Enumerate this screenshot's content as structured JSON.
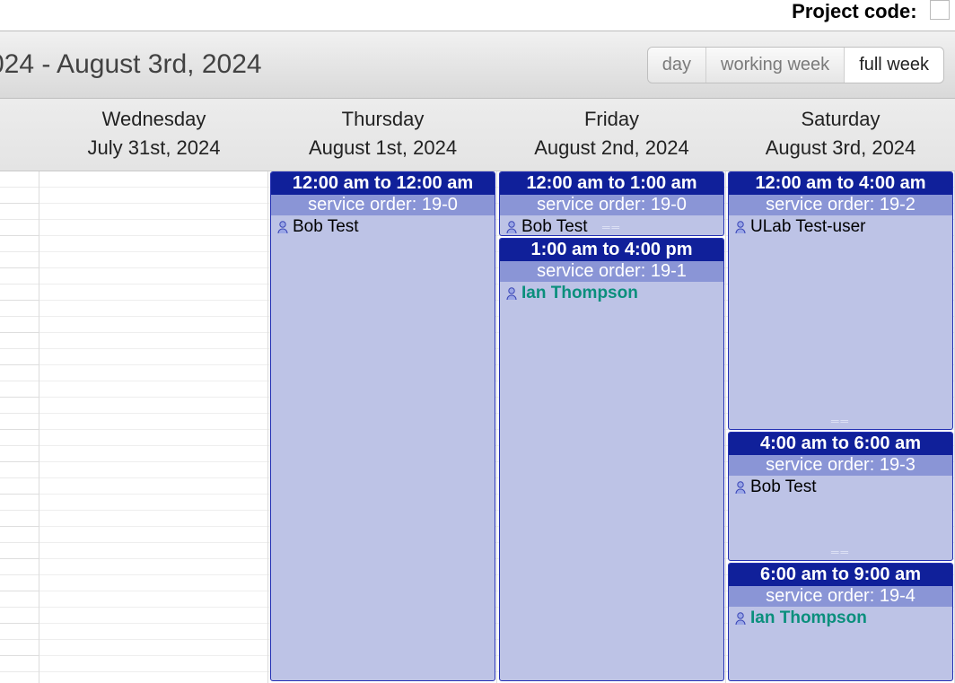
{
  "topbar": {
    "label": "Project code:",
    "value": ""
  },
  "header": {
    "title": "024 - August 3rd, 2024",
    "views": {
      "day": "day",
      "working_week": "working week",
      "full_week": "full week",
      "active": "full_week"
    }
  },
  "days": [
    {
      "dow": "Wednesday",
      "date": "July 31st, 2024"
    },
    {
      "dow": "Thursday",
      "date": "August 1st, 2024"
    },
    {
      "dow": "Friday",
      "date": "August 2nd, 2024"
    },
    {
      "dow": "Saturday",
      "date": "August 3rd, 2024"
    }
  ],
  "events": {
    "thursday": [
      {
        "time": "12:00 am to 12:00 am",
        "order": "service order: 19-0",
        "user": "Bob Test",
        "highlight": false
      }
    ],
    "friday": [
      {
        "time": "12:00 am to 1:00 am",
        "order": "service order: 19-0",
        "user": "Bob Test",
        "highlight": false
      },
      {
        "time": "1:00 am to 4:00 pm",
        "order": "service order: 19-1",
        "user": "Ian Thompson",
        "highlight": true
      }
    ],
    "saturday": [
      {
        "time": "12:00 am to 4:00 am",
        "order": "service order: 19-2",
        "user": "ULab Test-user",
        "highlight": false
      },
      {
        "time": "4:00 am to 6:00 am",
        "order": "service order: 19-3",
        "user": "Bob Test",
        "highlight": false
      },
      {
        "time": "6:00 am to 9:00 am",
        "order": "service order: 19-4",
        "user": "Ian Thompson",
        "highlight": true
      }
    ]
  }
}
